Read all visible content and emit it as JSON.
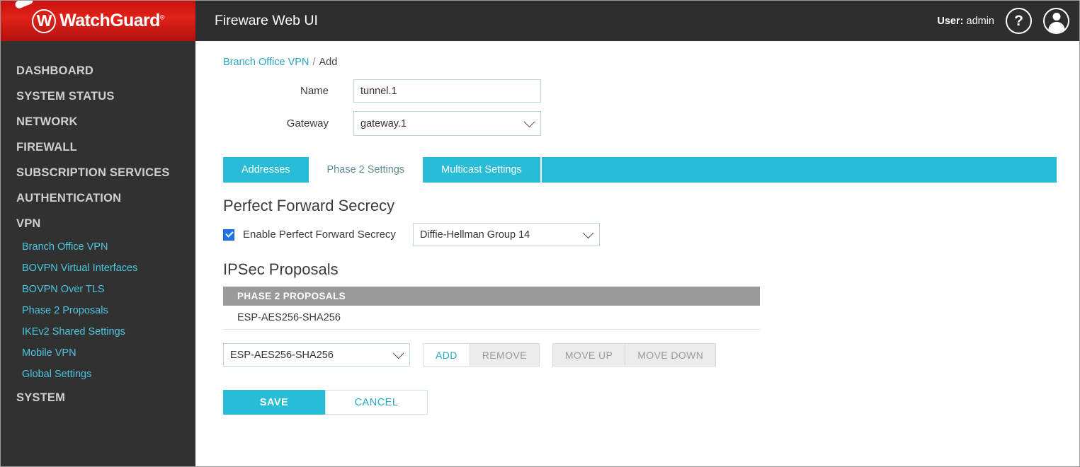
{
  "header": {
    "brand_name": "WatchGuard",
    "brand_tm": "®",
    "title": "Fireware Web UI",
    "user_prefix": "User:",
    "user_name": "admin",
    "help_glyph": "?",
    "accent_red": "#e02219",
    "topbar_bg": "#2e2e2e"
  },
  "sidebar": {
    "bg": "#313131",
    "link_color": "#4cc6e0",
    "items": [
      {
        "label": "DASHBOARD",
        "type": "top"
      },
      {
        "label": "SYSTEM STATUS",
        "type": "top"
      },
      {
        "label": "NETWORK",
        "type": "top"
      },
      {
        "label": "FIREWALL",
        "type": "top"
      },
      {
        "label": "SUBSCRIPTION SERVICES",
        "type": "top"
      },
      {
        "label": "AUTHENTICATION",
        "type": "top"
      },
      {
        "label": "VPN",
        "type": "top"
      },
      {
        "label": "Branch Office VPN",
        "type": "sub"
      },
      {
        "label": "BOVPN Virtual Interfaces",
        "type": "sub"
      },
      {
        "label": "BOVPN Over TLS",
        "type": "sub"
      },
      {
        "label": "Phase 2 Proposals",
        "type": "sub"
      },
      {
        "label": "IKEv2 Shared Settings",
        "type": "sub"
      },
      {
        "label": "Mobile VPN",
        "type": "sub"
      },
      {
        "label": "Global Settings",
        "type": "sub"
      },
      {
        "label": "SYSTEM",
        "type": "top"
      }
    ]
  },
  "breadcrumb": {
    "parent": "Branch Office VPN",
    "separator": "/",
    "current": "Add"
  },
  "form": {
    "name_label": "Name",
    "name_value": "tunnel.1",
    "name_placeholder": "",
    "gateway_label": "Gateway",
    "gateway_value": "gateway.1",
    "gateway_options": [
      "gateway.1"
    ]
  },
  "tabs": {
    "accent": "#29bcd6",
    "items": [
      {
        "label": "Addresses",
        "active": false
      },
      {
        "label": "Phase 2 Settings",
        "active": true
      },
      {
        "label": "Multicast Settings",
        "active": false
      }
    ]
  },
  "pfs": {
    "section_title": "Perfect Forward Secrecy",
    "checkbox_label": "Enable Perfect Forward Secrecy",
    "checkbox_checked": true,
    "checkbox_color": "#1a73e8",
    "group_value": "Diffie-Hellman Group 14",
    "group_options": [
      "Diffie-Hellman Group 14"
    ]
  },
  "proposals": {
    "section_title": "IPSec Proposals",
    "table_header": "PHASE 2 PROPOSALS",
    "header_bg": "#9a9a9a",
    "rows": [
      "ESP-AES256-SHA256"
    ],
    "select_value": "ESP-AES256-SHA256",
    "select_options": [
      "ESP-AES256-SHA256"
    ],
    "buttons": [
      {
        "label": "ADD",
        "enabled": true
      },
      {
        "label": "REMOVE",
        "enabled": false
      },
      {
        "label": "MOVE UP",
        "enabled": false
      },
      {
        "label": "MOVE DOWN",
        "enabled": false
      }
    ]
  },
  "footer": {
    "save_label": "SAVE",
    "cancel_label": "CANCEL"
  }
}
